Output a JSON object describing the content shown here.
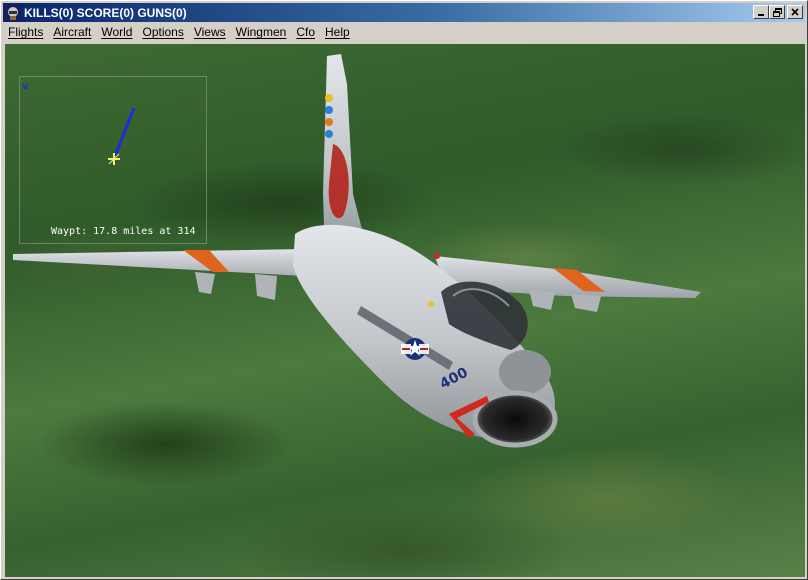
{
  "window": {
    "title": "KILLS(0) SCORE(0) GUNS(0)",
    "controls": {
      "minimize": "_",
      "restore": "🗗",
      "close": "✕"
    }
  },
  "menu": {
    "items": [
      "Flights",
      "Aircraft",
      "World",
      "Options",
      "Views",
      "Wingmen",
      "Cfo",
      "Help"
    ]
  },
  "hud": {
    "waypoint_text": "Waypt: 17.8 miles at 314"
  },
  "aircraft": {
    "tail_code": "400"
  },
  "icons": {
    "app": "pilot-helmet-icon",
    "compass_north": "north-marker-icon",
    "waypoint_marker": "waypoint-marker-icon",
    "heading_line": "heading-line-icon"
  },
  "colors": {
    "titlebar_start": "#0a246a",
    "titlebar_end": "#a6caf0",
    "heading_line": "#1a2fd8",
    "waypoint_marker": "#f5f06a",
    "terrain": "#3f6a33",
    "aircraft_body": "#c9ccd0",
    "stripe": "#e0641e"
  }
}
